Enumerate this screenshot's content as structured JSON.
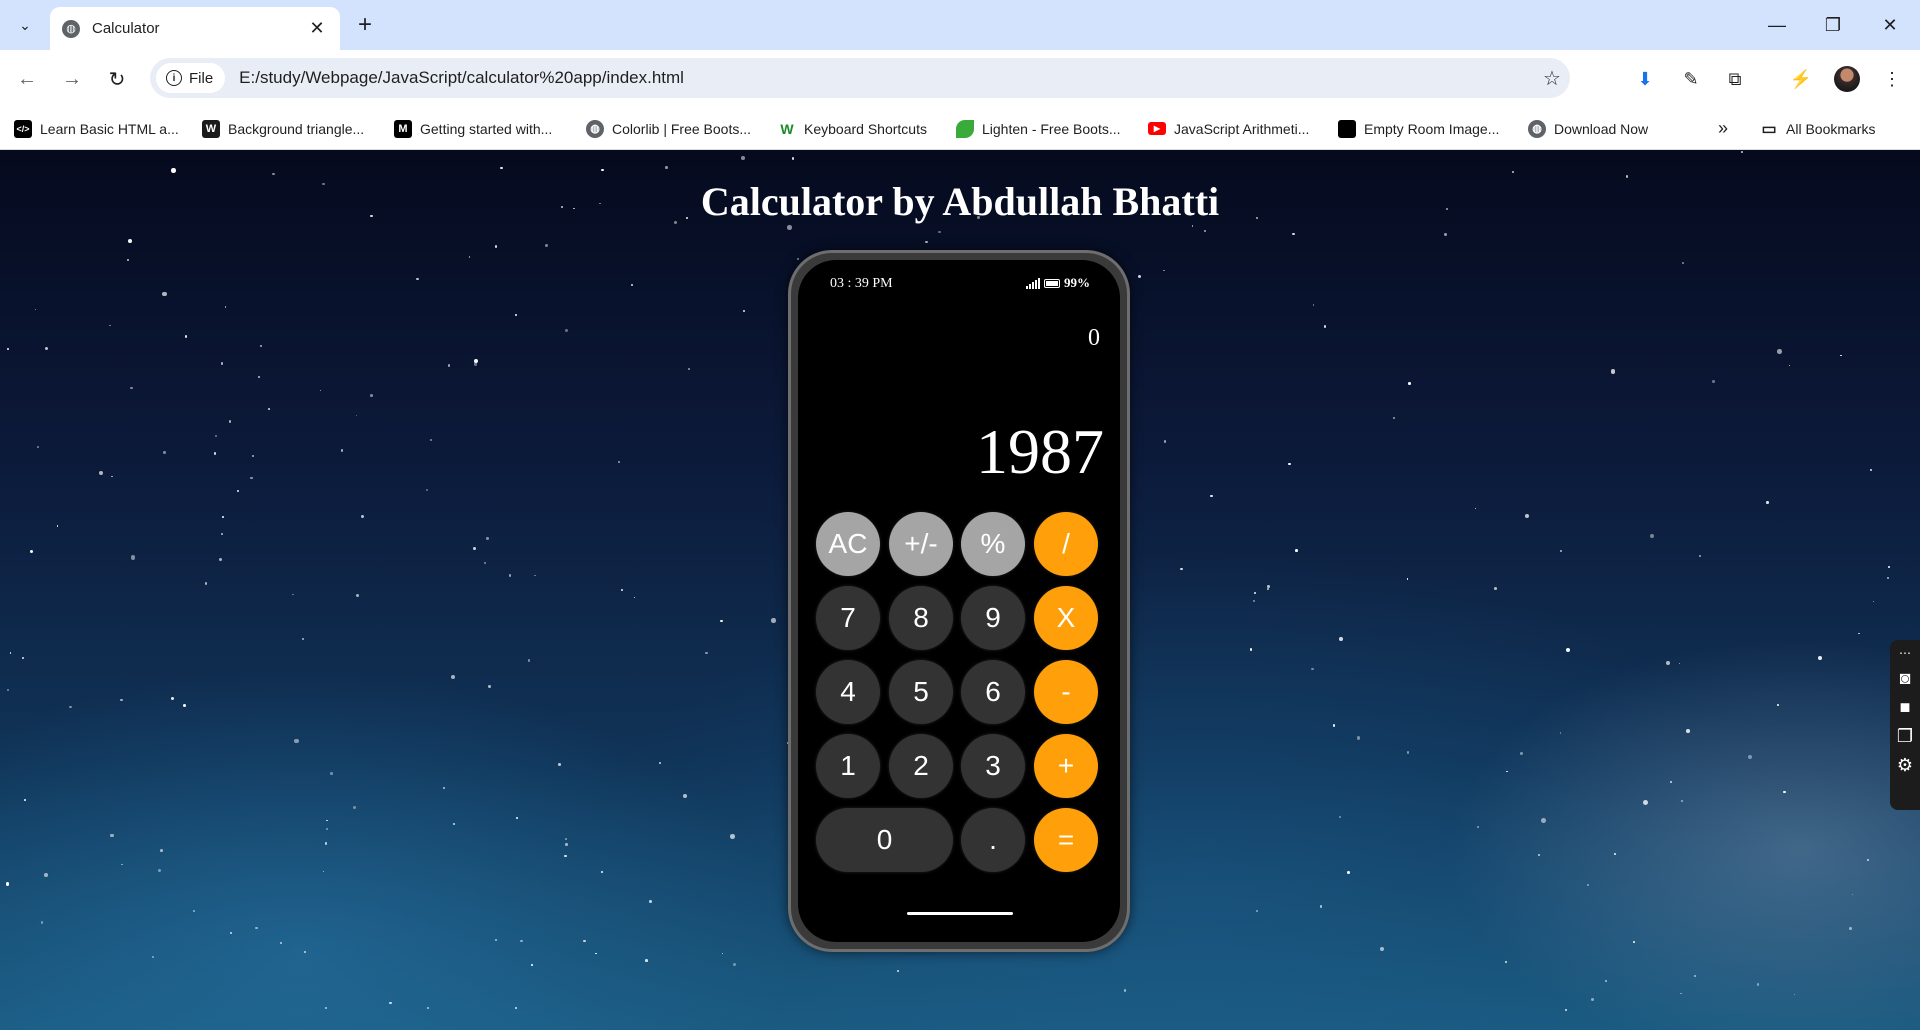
{
  "browser": {
    "tab_title": "Calculator",
    "new_tab": "+",
    "site_chip": "File",
    "url": "E:/study/Webpage/JavaScript/calculator%20app/index.html",
    "bookmarks": [
      {
        "label": "Learn Basic HTML a...",
        "icon": "</>",
        "color": "#000000"
      },
      {
        "label": "Background triangle...",
        "icon": "W",
        "color": "#1a1a1a"
      },
      {
        "label": "Getting started with...",
        "icon": "M",
        "color": "#000000"
      },
      {
        "label": "Colorlib | Free Boots...",
        "icon": "globe-icon",
        "color": "#5f6368"
      },
      {
        "label": "Keyboard Shortcuts",
        "icon": "W",
        "color": "#1a8a2a"
      },
      {
        "label": "Lighten - Free Boots...",
        "icon": "leaf-icon",
        "color": "#3aaa3a"
      },
      {
        "label": "JavaScript Arithmeti...",
        "icon": "youtube-icon",
        "color": "#ff0000"
      },
      {
        "label": "Empty Room Image...",
        "icon": "square-icon",
        "color": "#000000"
      },
      {
        "label": "Download Now",
        "icon": "globe-icon",
        "color": "#5f6368"
      }
    ],
    "all_bookmarks": "All Bookmarks"
  },
  "page": {
    "title": "Calculator by Abdullah Bhatti"
  },
  "calculator": {
    "status_time": "03 : 39 PM",
    "battery": "99%",
    "previous_value": "0",
    "current_value": "1987",
    "keys": {
      "ac": "AC",
      "sign": "+/-",
      "percent": "%",
      "divide": "/",
      "seven": "7",
      "eight": "8",
      "nine": "9",
      "multiply": "X",
      "four": "4",
      "five": "5",
      "six": "6",
      "minus": "-",
      "one": "1",
      "two": "2",
      "three": "3",
      "plus": "+",
      "zero": "0",
      "decimal": ".",
      "equals": "="
    },
    "colors": {
      "function_key": "#a5a5a5",
      "number_key": "#333333",
      "operator_key": "#ff9f0a"
    }
  }
}
